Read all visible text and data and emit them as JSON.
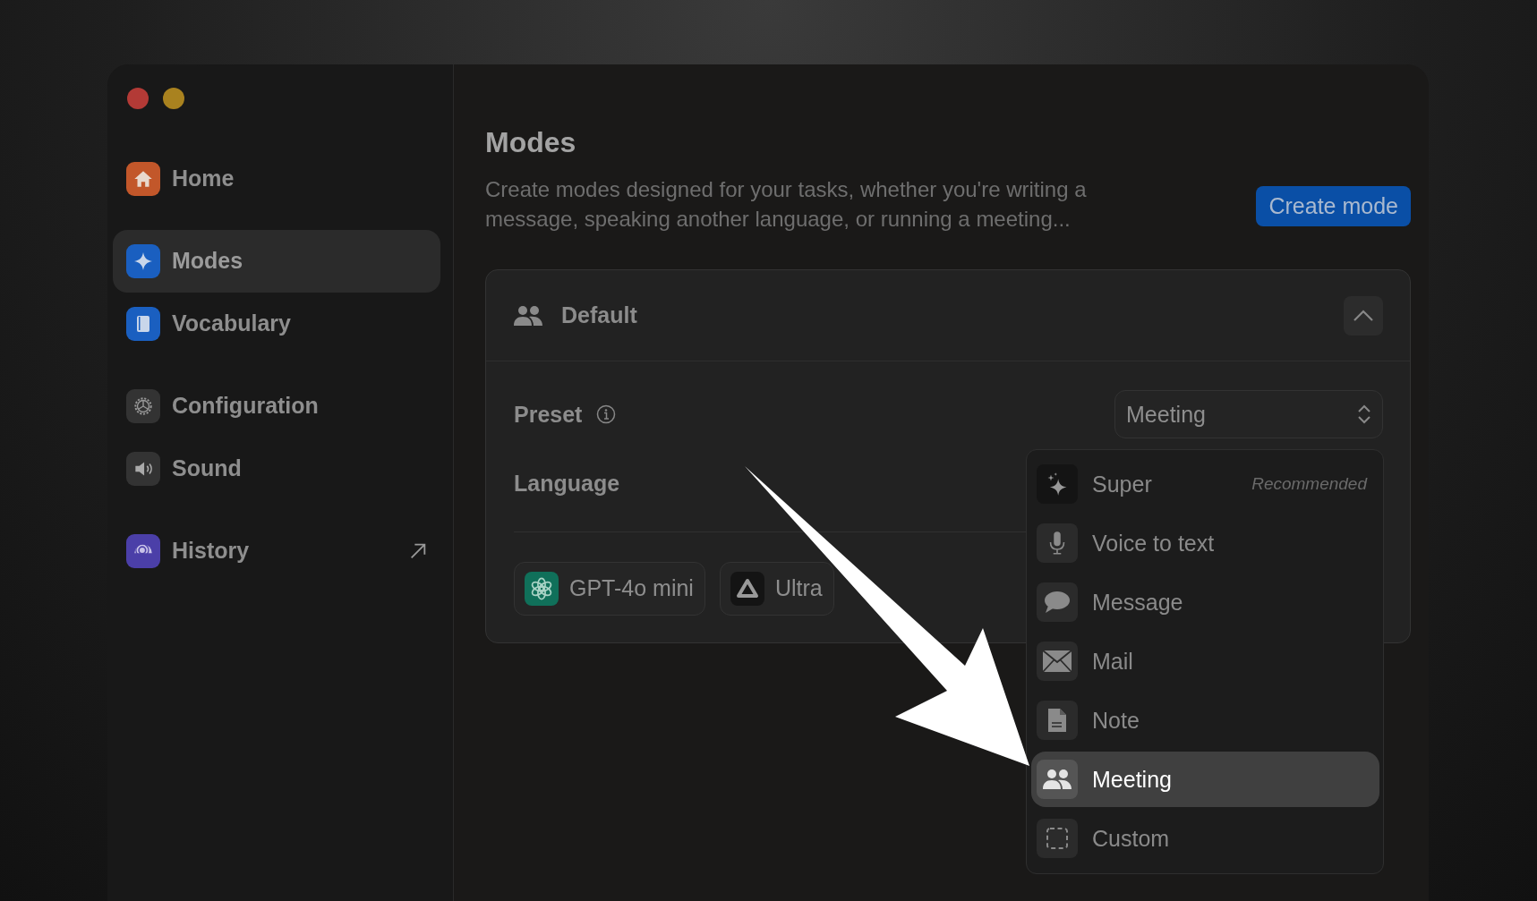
{
  "sidebar": {
    "groups": [
      [
        {
          "label": "Home",
          "selected": false
        }
      ],
      [
        {
          "label": "Modes",
          "selected": true
        },
        {
          "label": "Vocabulary",
          "selected": false
        }
      ],
      [
        {
          "label": "Configuration",
          "selected": false
        },
        {
          "label": "Sound",
          "selected": false
        }
      ],
      [
        {
          "label": "History",
          "selected": false
        }
      ]
    ]
  },
  "page": {
    "title": "Modes",
    "description": "Create modes designed for your tasks, whether you're writing a message, speaking another language, or running a meeting...",
    "create_button": "Create mode"
  },
  "mode_card": {
    "title": "Default",
    "expanded": true,
    "preset": {
      "label": "Preset",
      "value": "Meeting"
    },
    "language": {
      "label": "Language"
    },
    "chips": [
      {
        "label": "GPT-4o mini"
      },
      {
        "label": "Ultra"
      }
    ]
  },
  "preset_menu": [
    {
      "label": "Super",
      "note": "Recommended",
      "selected": false
    },
    {
      "label": "Voice to text",
      "selected": false
    },
    {
      "label": "Message",
      "selected": false
    },
    {
      "label": "Mail",
      "selected": false
    },
    {
      "label": "Note",
      "selected": false
    },
    {
      "label": "Meeting",
      "selected": true
    },
    {
      "label": "Custom",
      "selected": false
    }
  ]
}
